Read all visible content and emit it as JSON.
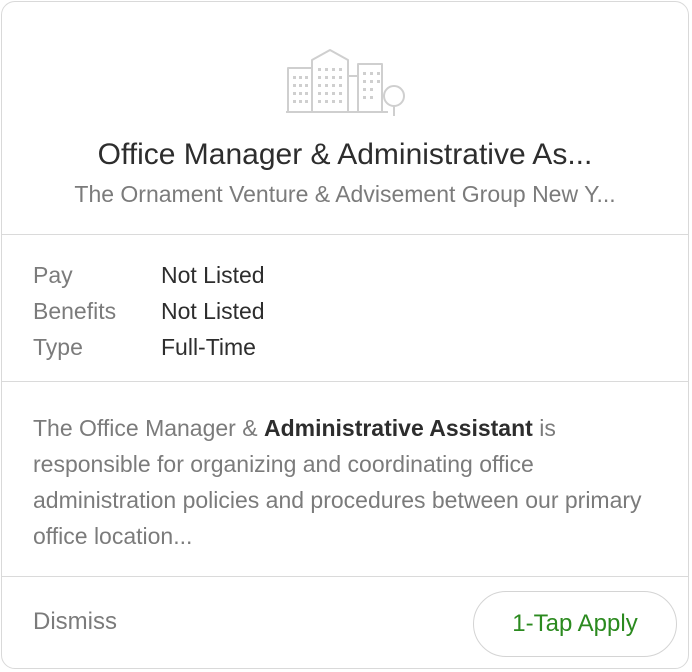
{
  "job": {
    "logo_icon": "building-icon",
    "title": "Office Manager & Administrative As...",
    "company": "The Ornament Venture & Advisement Group New Y..."
  },
  "details": [
    {
      "label": "Pay",
      "value": "Not Listed"
    },
    {
      "label": "Benefits",
      "value": "Not Listed"
    },
    {
      "label": "Type",
      "value": "Full-Time"
    }
  ],
  "description": {
    "before": "The Office Manager & ",
    "highlight": "Administrative Assistant",
    "after": " is responsible for organizing and coordinating office administration policies and procedures between our primary office location..."
  },
  "actions": {
    "dismiss_label": "Dismiss",
    "apply_label": "1-Tap Apply",
    "apply_color": "#2b8a1f"
  }
}
